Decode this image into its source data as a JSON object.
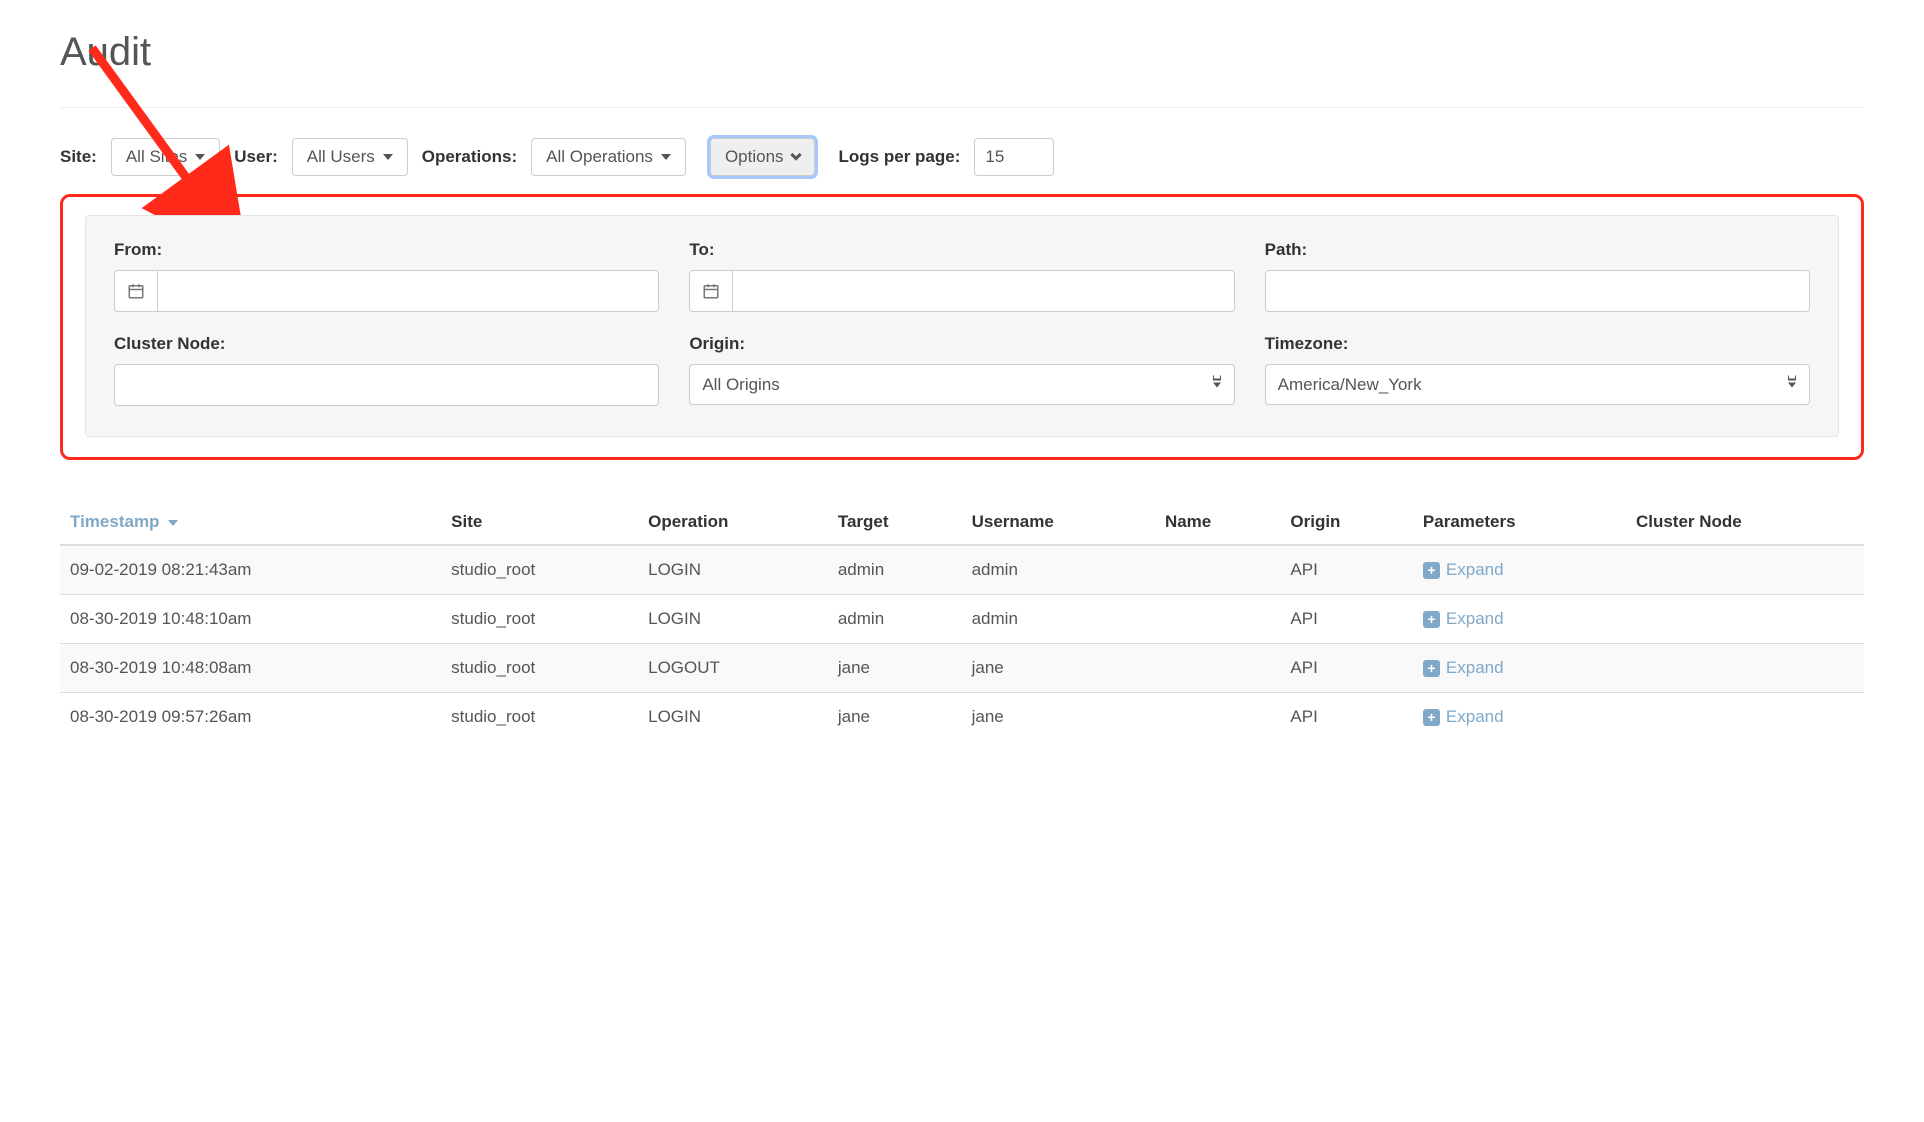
{
  "page": {
    "title": "Audit"
  },
  "filters": {
    "site_label": "Site:",
    "site_value": "All Sites",
    "user_label": "User:",
    "user_value": "All Users",
    "operations_label": "Operations:",
    "operations_value": "All Operations",
    "options_label": "Options",
    "logs_per_page_label": "Logs per page:",
    "logs_per_page_value": "15"
  },
  "options": {
    "from_label": "From:",
    "from_value": "",
    "to_label": "To:",
    "to_value": "",
    "path_label": "Path:",
    "path_value": "",
    "cluster_node_label": "Cluster Node:",
    "cluster_node_value": "",
    "origin_label": "Origin:",
    "origin_value": "All Origins",
    "timezone_label": "Timezone:",
    "timezone_value": "America/New_York"
  },
  "table": {
    "headers": {
      "timestamp": "Timestamp",
      "site": "Site",
      "operation": "Operation",
      "target": "Target",
      "username": "Username",
      "name": "Name",
      "origin": "Origin",
      "parameters": "Parameters",
      "cluster_node": "Cluster Node"
    },
    "expand_label": "Expand",
    "rows": [
      {
        "timestamp": "09-02-2019 08:21:43am",
        "site": "studio_root",
        "operation": "LOGIN",
        "target": "admin",
        "username": "admin",
        "name": "",
        "origin": "API",
        "cluster_node": ""
      },
      {
        "timestamp": "08-30-2019 10:48:10am",
        "site": "studio_root",
        "operation": "LOGIN",
        "target": "admin",
        "username": "admin",
        "name": "",
        "origin": "API",
        "cluster_node": ""
      },
      {
        "timestamp": "08-30-2019 10:48:08am",
        "site": "studio_root",
        "operation": "LOGOUT",
        "target": "jane",
        "username": "jane",
        "name": "",
        "origin": "API",
        "cluster_node": ""
      },
      {
        "timestamp": "08-30-2019 09:57:26am",
        "site": "studio_root",
        "operation": "LOGIN",
        "target": "jane",
        "username": "jane",
        "name": "",
        "origin": "API",
        "cluster_node": ""
      }
    ]
  },
  "colors": {
    "highlight_border": "#ff2a1a",
    "link": "#7fa8c9"
  }
}
